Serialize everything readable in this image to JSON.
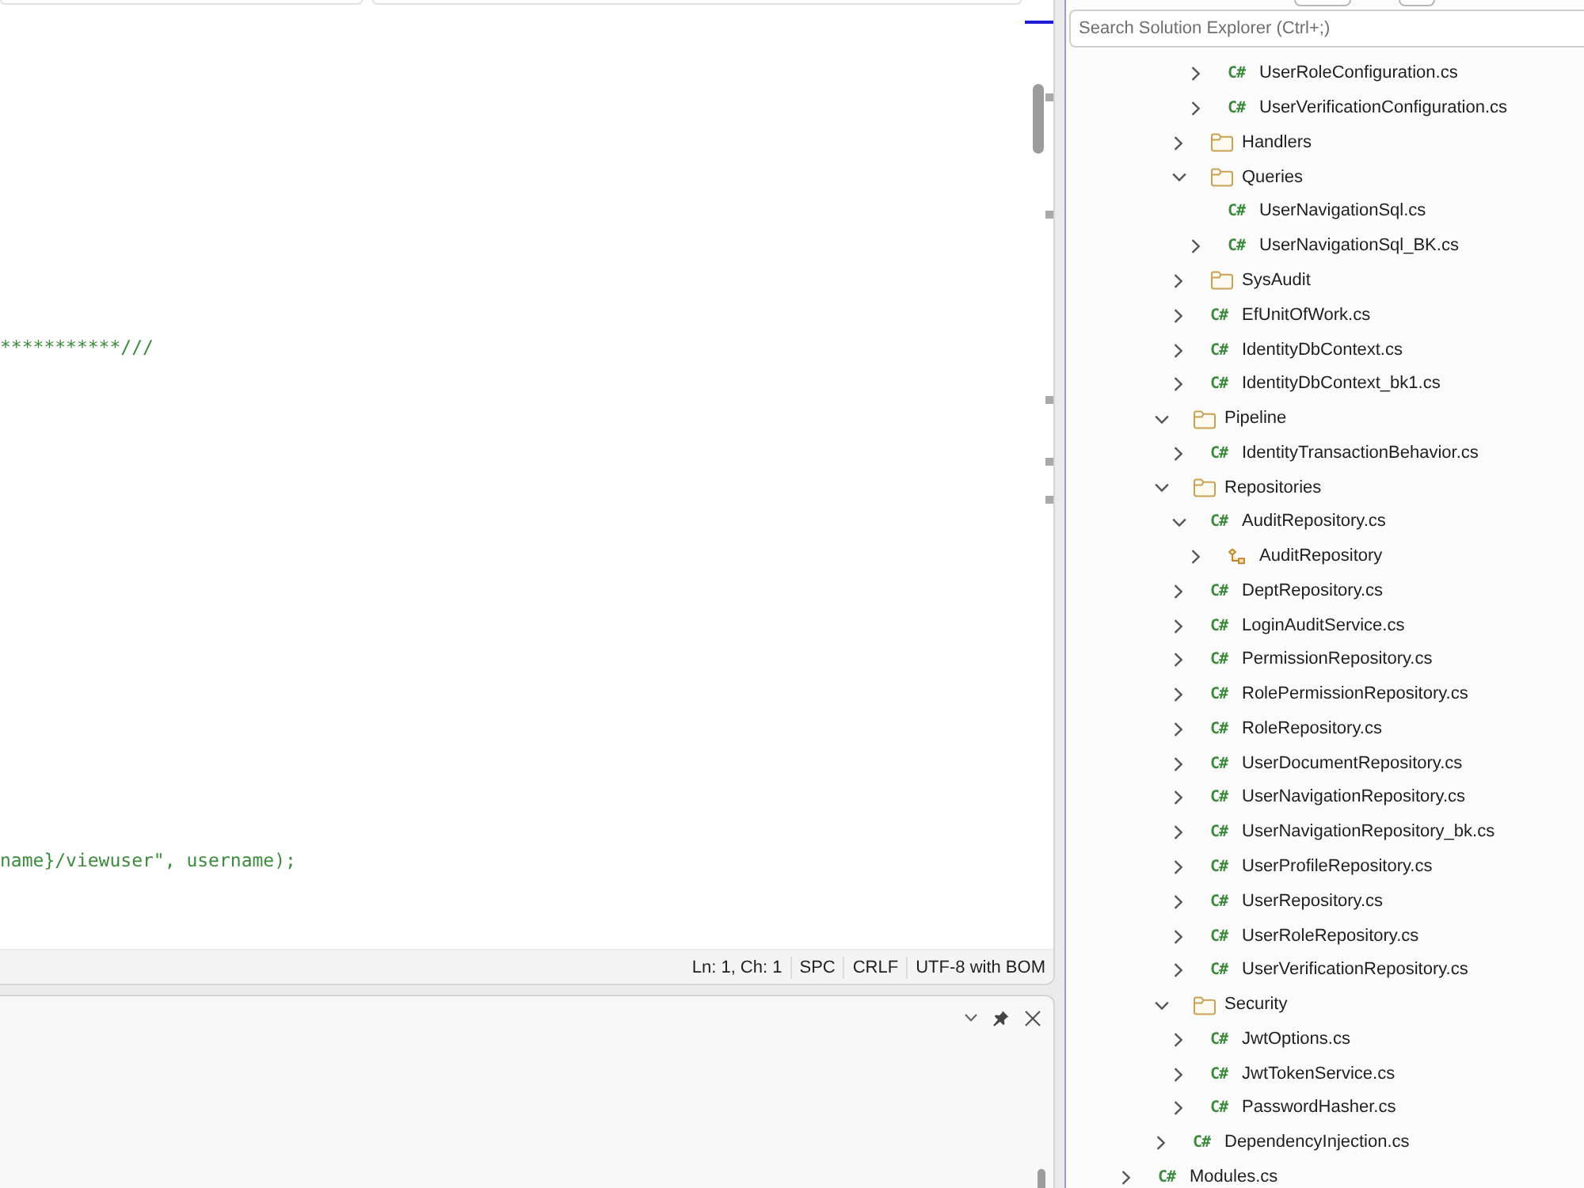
{
  "editor": {
    "code_lines": [
      "***********///",
      "name}/viewuser\", username);"
    ]
  },
  "status_bar": {
    "items": [
      "Ln: 1, Ch: 1",
      "SPC",
      "CRLF",
      "UTF-8 with BOM"
    ]
  },
  "solution_explorer": {
    "search": {
      "placeholder": "Search Solution Explorer (Ctrl+;)"
    },
    "tree": [
      {
        "kind": "continuation",
        "children": [
          {
            "kind": "continuation",
            "children": [
              {
                "kind": "continuation",
                "children": [
                  {
                    "kind": "continuation",
                    "children": [
                      {
                        "kind": "file",
                        "type": "C#",
                        "label": "UserRoleConfiguration.cs",
                        "expandable": true,
                        "expanded": false,
                        "selected": false
                      },
                      {
                        "kind": "file",
                        "type": "C#",
                        "label": "UserVerificationConfiguration.cs",
                        "expandable": true,
                        "expanded": false,
                        "selected": false
                      }
                    ]
                  },
                  {
                    "kind": "folder",
                    "label": "Handlers",
                    "expandable": true,
                    "expanded": false,
                    "selected": false
                  },
                  {
                    "kind": "folder",
                    "label": "Queries",
                    "expandable": true,
                    "expanded": true,
                    "selected": false,
                    "children": [
                      {
                        "kind": "file",
                        "type": "C#",
                        "label": "UserNavigationSql.cs",
                        "expandable": false,
                        "expanded": false,
                        "selected": false
                      },
                      {
                        "kind": "file",
                        "type": "C#",
                        "label": "UserNavigationSql_BK.cs",
                        "expandable": true,
                        "expanded": false,
                        "selected": false
                      }
                    ]
                  },
                  {
                    "kind": "folder",
                    "label": "SysAudit",
                    "expandable": true,
                    "expanded": false,
                    "selected": false
                  },
                  {
                    "kind": "file",
                    "type": "C#",
                    "label": "EfUnitOfWork.cs",
                    "expandable": true,
                    "expanded": false,
                    "selected": false
                  },
                  {
                    "kind": "file",
                    "type": "C#",
                    "label": "IdentityDbContext.cs",
                    "expandable": true,
                    "expanded": false,
                    "selected": false
                  },
                  {
                    "kind": "file",
                    "type": "C#",
                    "label": "IdentityDbContext_bk1.cs",
                    "expandable": true,
                    "expanded": false,
                    "selected": false
                  }
                ]
              },
              {
                "kind": "folder",
                "label": "Pipeline",
                "expandable": true,
                "expanded": true,
                "selected": false,
                "children": [
                  {
                    "kind": "file",
                    "type": "C#",
                    "label": "IdentityTransactionBehavior.cs",
                    "expandable": true,
                    "expanded": false,
                    "selected": false
                  }
                ]
              },
              {
                "kind": "folder",
                "label": "Repositories",
                "expandable": true,
                "expanded": true,
                "selected": false,
                "children": [
                  {
                    "kind": "file",
                    "type": "C#",
                    "label": "AuditRepository.cs",
                    "expandable": true,
                    "expanded": true,
                    "selected": false,
                    "children": [
                      {
                        "kind": "class",
                        "label": "AuditRepository",
                        "expandable": true,
                        "expanded": false,
                        "selected": false
                      }
                    ]
                  },
                  {
                    "kind": "file",
                    "type": "C#",
                    "label": "DeptRepository.cs",
                    "expandable": true,
                    "expanded": false,
                    "selected": false
                  },
                  {
                    "kind": "file",
                    "type": "C#",
                    "label": "LoginAuditService.cs",
                    "expandable": true,
                    "expanded": false,
                    "selected": false
                  },
                  {
                    "kind": "file",
                    "type": "C#",
                    "label": "PermissionRepository.cs",
                    "expandable": true,
                    "expanded": false,
                    "selected": false
                  },
                  {
                    "kind": "file",
                    "type": "C#",
                    "label": "RolePermissionRepository.cs",
                    "expandable": true,
                    "expanded": false,
                    "selected": false
                  },
                  {
                    "kind": "file",
                    "type": "C#",
                    "label": "RoleRepository.cs",
                    "expandable": true,
                    "expanded": false,
                    "selected": false
                  },
                  {
                    "kind": "file",
                    "type": "C#",
                    "label": "UserDocumentRepository.cs",
                    "expandable": true,
                    "expanded": false,
                    "selected": false
                  },
                  {
                    "kind": "file",
                    "type": "C#",
                    "label": "UserNavigationRepository.cs",
                    "expandable": true,
                    "expanded": false,
                    "selected": false
                  },
                  {
                    "kind": "file",
                    "type": "C#",
                    "label": "UserNavigationRepository_bk.cs",
                    "expandable": true,
                    "expanded": false,
                    "selected": false
                  },
                  {
                    "kind": "file",
                    "type": "C#",
                    "label": "UserProfileRepository.cs",
                    "expandable": true,
                    "expanded": false,
                    "selected": false
                  },
                  {
                    "kind": "file",
                    "type": "C#",
                    "label": "UserRepository.cs",
                    "expandable": true,
                    "expanded": false,
                    "selected": false
                  },
                  {
                    "kind": "file",
                    "type": "C#",
                    "label": "UserRoleRepository.cs",
                    "expandable": true,
                    "expanded": false,
                    "selected": false
                  },
                  {
                    "kind": "file",
                    "type": "C#",
                    "label": "UserVerificationRepository.cs",
                    "expandable": true,
                    "expanded": false,
                    "selected": false
                  }
                ]
              },
              {
                "kind": "folder",
                "label": "Security",
                "expandable": true,
                "expanded": true,
                "selected": false,
                "children": [
                  {
                    "kind": "file",
                    "type": "C#",
                    "label": "JwtOptions.cs",
                    "expandable": true,
                    "expanded": false,
                    "selected": false
                  },
                  {
                    "kind": "file",
                    "type": "C#",
                    "label": "JwtTokenService.cs",
                    "expandable": true,
                    "expanded": false,
                    "selected": false
                  },
                  {
                    "kind": "file",
                    "type": "C#",
                    "label": "PasswordHasher.cs",
                    "expandable": true,
                    "expanded": false,
                    "selected": false
                  }
                ]
              },
              {
                "kind": "file",
                "type": "C#",
                "label": "DependencyInjection.cs",
                "expandable": true,
                "expanded": false,
                "selected": false
              }
            ]
          }
        ]
      },
      {
        "kind": "file",
        "type": "C#",
        "label": "Modules.cs",
        "expandable": true,
        "expanded": false,
        "selected": false
      }
    ]
  }
}
